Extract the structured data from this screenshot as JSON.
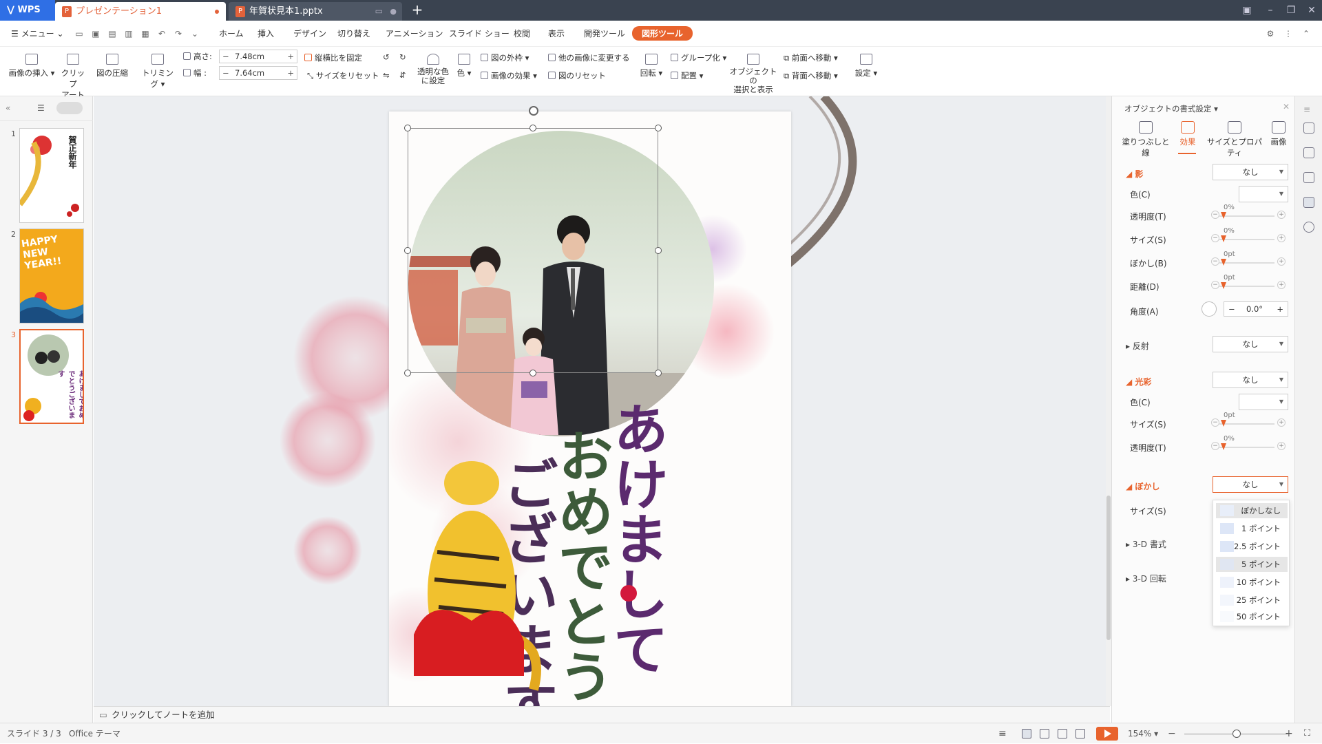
{
  "titlebar": {
    "app_name": "WPS",
    "tabs": [
      {
        "label": "プレゼンテーション1",
        "active": true
      },
      {
        "label": "年賀状見本1.pptx",
        "active": false
      }
    ],
    "new_tab": "+"
  },
  "menubar": {
    "menu_label": "メニュー",
    "items": [
      "ホーム",
      "挿入",
      "デザイン",
      "切り替え",
      "アニメーション",
      "スライド ショー",
      "校閲",
      "表示",
      "開発ツール",
      "図形ツール"
    ],
    "highlighted": "図形ツール"
  },
  "ribbon": {
    "insert_image": "画像の挿入",
    "clipart": "クリップ\nアート",
    "compress": "図の圧縮",
    "trim": "トリミング",
    "height_label": "高さ:",
    "height_value": "7.48cm",
    "width_label": "幅 :",
    "width_value": "7.64cm",
    "lock_ratio": "縦横比を固定",
    "reset_size": "サイズをリセット",
    "transparent": "透明な色\nに設定",
    "color": "色",
    "border": "図の外枠",
    "effects": "画像の効果",
    "change_image": "他の画像に変更する",
    "reset_image": "図のリセット",
    "rotate": "回転",
    "group": "グループ化",
    "arrange": "配置",
    "select_show": "オブジェクトの\n選択と表示",
    "bring_forward": "前面へ移動",
    "send_backward": "背面へ移動",
    "settings": "設定"
  },
  "slides": [
    {
      "number": "1",
      "text": "賀正新年"
    },
    {
      "number": "2",
      "text": "HAPPY NEW YEAR!!"
    },
    {
      "number": "3",
      "text": "あけましておめでとうございます"
    }
  ],
  "slide": {
    "calligraphy": [
      "あけまして",
      "おめでとう",
      "ございます"
    ]
  },
  "notes": {
    "placeholder": "クリックしてノートを追加"
  },
  "format_panel": {
    "title": "オブジェクトの書式設定",
    "tabs": [
      "塗りつぶしと線",
      "効果",
      "サイズとプロパティ",
      "画像"
    ],
    "active_tab": "効果",
    "shadow": {
      "label": "影",
      "value": "なし",
      "color": "色(C)",
      "transparency": "透明度(T)",
      "size": "サイズ(S)",
      "blur": "ぼかし(B)",
      "distance": "距離(D)",
      "angle": "角度(A)",
      "angle_value": "0.0°",
      "pct": "0%",
      "pt": "0pt"
    },
    "reflection": {
      "label": "反射",
      "value": "なし"
    },
    "glow": {
      "label": "光彩",
      "value": "なし",
      "color": "色(C)",
      "size": "サイズ(S)",
      "transparency": "透明度(T)",
      "pt": "0pt",
      "pct": "0%"
    },
    "soft_edges": {
      "label": "ぼかし",
      "value": "なし",
      "size": "サイズ(S)"
    },
    "format_3d": "3-D 書式",
    "rotation_3d": "3-D 回転",
    "dropdown_options": [
      "ぼかしなし",
      "1 ポイント",
      "2.5 ポイント",
      "5 ポイント",
      "10 ポイント",
      "25 ポイント",
      "50 ポイント"
    ]
  },
  "status": {
    "slide_info": "スライド 3 / 3",
    "theme": "Office テーマ",
    "zoom": "154%"
  },
  "colors": {
    "accent": "#e8632d",
    "titlebar": "#3a4350",
    "wps_blue": "#2f6fe5"
  }
}
